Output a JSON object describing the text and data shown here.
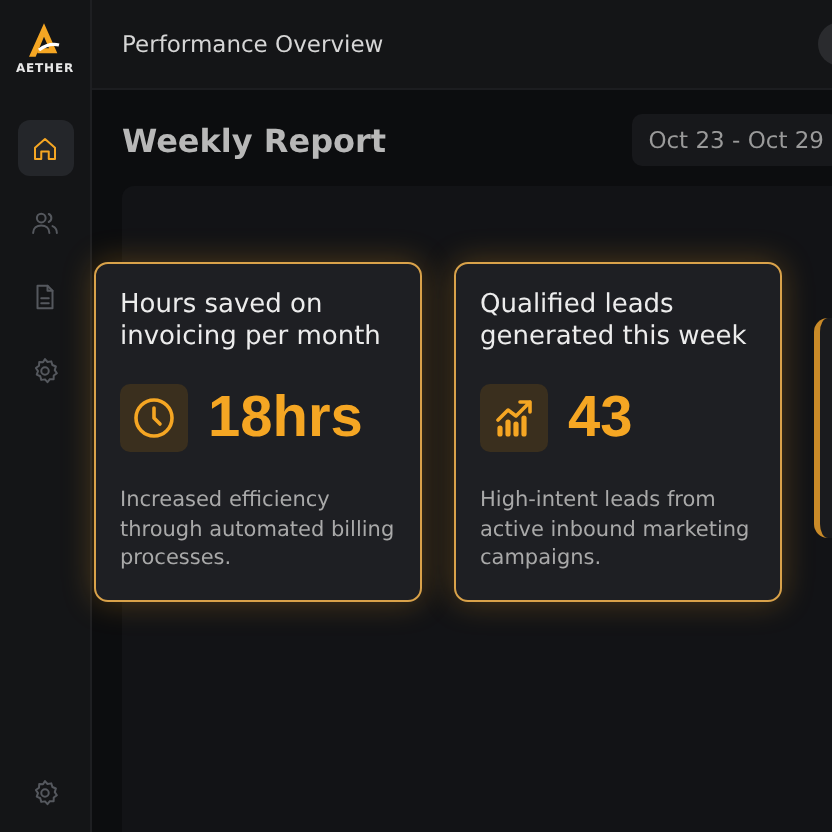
{
  "brand": {
    "name": "AETHER"
  },
  "sidebar": {
    "items": [
      {
        "kind": "home",
        "selected": true
      },
      {
        "kind": "users",
        "selected": false
      },
      {
        "kind": "file",
        "selected": false
      },
      {
        "kind": "gear",
        "selected": false
      }
    ],
    "footer": {
      "kind": "gear"
    }
  },
  "header": {
    "title": "Performance Overview"
  },
  "report": {
    "title": "Weekly Report",
    "date_range": "Oct 23 - Oct 29"
  },
  "cards": [
    {
      "kind": "clock",
      "title": "Hours saved on invoicing per month",
      "value": "18hrs",
      "description": "Increased efficiency through automated billing processes."
    },
    {
      "kind": "chart",
      "title": "Qualified leads generated this week",
      "value": "43",
      "description": "High-intent leads from active inbound marketing campaigns."
    }
  ]
}
